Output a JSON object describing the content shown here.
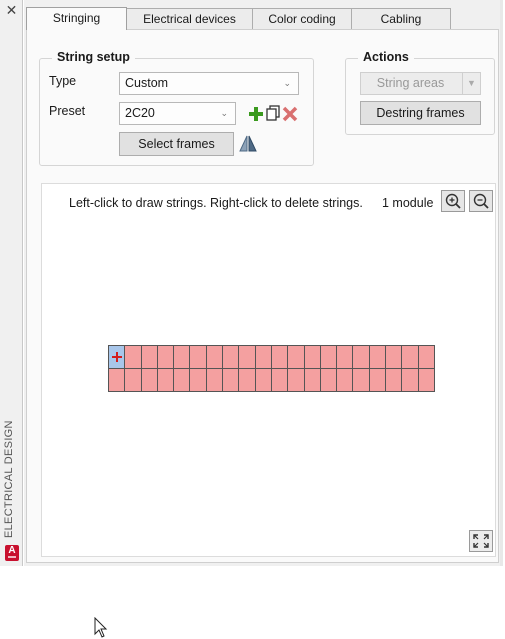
{
  "palette": {
    "close_glyph": "✕",
    "title": "ELECTRICAL DESIGN",
    "logo_letter": "A"
  },
  "tabs": [
    {
      "label": "Stringing",
      "active": true
    },
    {
      "label": "Electrical devices",
      "active": false
    },
    {
      "label": "Color coding",
      "active": false
    },
    {
      "label": "Cabling",
      "active": false
    }
  ],
  "string_setup": {
    "title": "String setup",
    "type_label": "Type",
    "type_value": "Custom",
    "preset_label": "Preset",
    "preset_value": "2C20",
    "select_frames_label": "Select frames",
    "icons": [
      "add-icon",
      "copy-icon",
      "delete-icon",
      "mirror-icon"
    ]
  },
  "actions": {
    "title": "Actions",
    "string_areas_label": "String areas",
    "string_areas_enabled": false,
    "destring_label": "Destring frames"
  },
  "canvas": {
    "hint": "Left-click to draw strings. Right-click to delete strings.",
    "module_count": "1 module",
    "grid": {
      "rows": 2,
      "columns": 20,
      "selected_cell": [
        0,
        0
      ]
    },
    "colors": {
      "module_fill": "#f4a0a0",
      "selected_fill": "#a8c6ea",
      "marker": "#d21c1c"
    }
  }
}
